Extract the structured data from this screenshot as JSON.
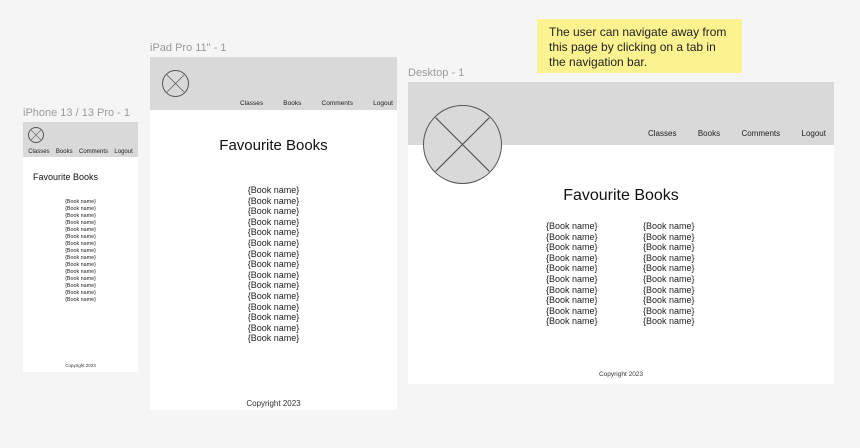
{
  "labels": {
    "phone": "iPhone 13 / 13 Pro - 1",
    "ipad": "iPad Pro 11\" - 1",
    "desktop": "Desktop - 1"
  },
  "nav": [
    "Classes",
    "Books",
    "Comments",
    "Logout"
  ],
  "title": "Favourite Books",
  "copyright": "Copyright 2023",
  "note": "The user can navigate away from this page by clicking on a tab in the navigation bar.",
  "colors": {
    "header": "#d9d9d9",
    "note": "#fcf28f",
    "canvas": "#f5f5f5"
  },
  "phone_books": [
    "{Book name}",
    "{Book name}",
    "{Book name}",
    "{Book name}",
    "{Book name}",
    "{Book name}",
    "{Book name}",
    "{Book name}",
    "{Book name}",
    "{Book name}",
    "{Book name}",
    "{Book name}",
    "{Book name}",
    "{Book name}",
    "{Book name}"
  ],
  "ipad_books": [
    "{Book name}",
    "{Book name}",
    "{Book name}",
    "{Book name}",
    "{Book name}",
    "{Book name}",
    "{Book name}",
    "{Book name}",
    "{Book name}",
    "{Book name}",
    "{Book name}",
    "{Book name}",
    "{Book name}",
    "{Book name}",
    "{Book name}"
  ],
  "desktop_books_col1": [
    "{Book name}",
    "{Book name}",
    "{Book name}",
    "{Book name}",
    "{Book name}",
    "{Book name}",
    "{Book name}",
    "{Book name}",
    "{Book name}",
    "{Book name}"
  ],
  "desktop_books_col2": [
    "{Book name}",
    "{Book name}",
    "{Book name}",
    "{Book name}",
    "{Book name}",
    "{Book name}",
    "{Book name}",
    "{Book name}",
    "{Book name}",
    "{Book name}"
  ]
}
